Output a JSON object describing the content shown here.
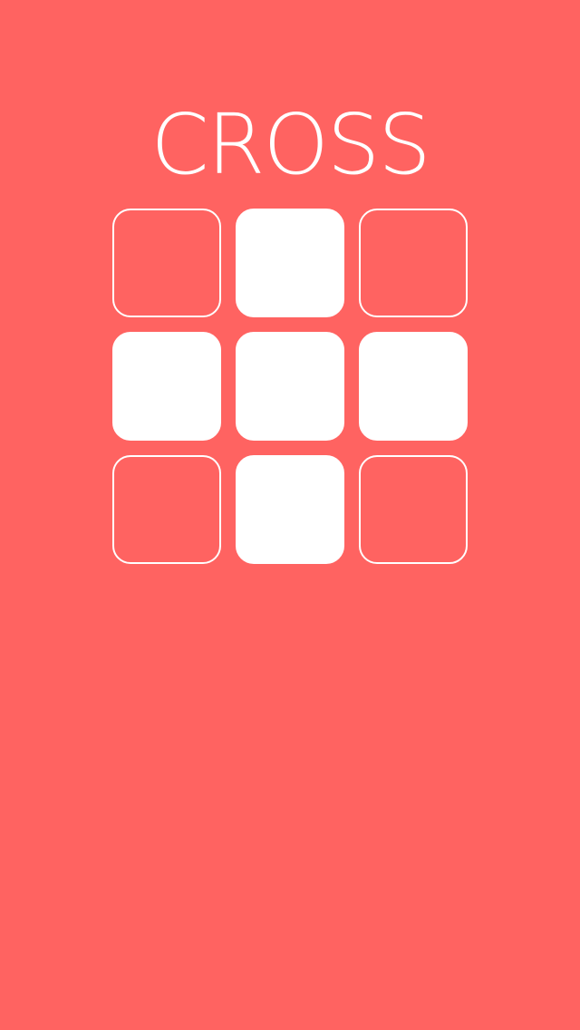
{
  "game": {
    "title": "CROSS",
    "background_color": "#ff6361",
    "tile_color": "#ffffff",
    "grid": {
      "rows": 3,
      "cols": 3,
      "cells": [
        [
          false,
          true,
          false
        ],
        [
          true,
          true,
          true
        ],
        [
          false,
          true,
          false
        ]
      ]
    }
  }
}
